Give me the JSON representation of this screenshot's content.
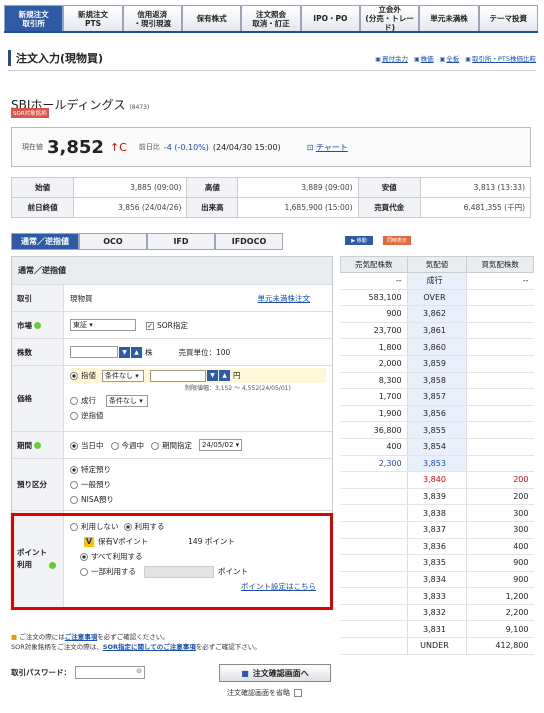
{
  "nav": [
    "新規注文\n取引所",
    "新規注文\nPTS",
    "信用返済\n・現引現渡",
    "保有株式",
    "注文照会\n取消・訂正",
    "IPO・PO",
    "立会外\n(分売・トレード)",
    "単元未満株",
    "テーマ投資"
  ],
  "page_title": "注文入力(現物買)",
  "title_links": [
    "買付余力",
    "株価",
    "全板",
    "取引所・PTS株価比較"
  ],
  "stock": {
    "name": "SBIホールディングス",
    "code": "(8473)",
    "badge": "SOR対象銘柄"
  },
  "price": {
    "label": "現在値",
    "value": "3,852",
    "arrow": "↑C",
    "prev_label": "前日比",
    "change": "-4 (-0.10%)",
    "time": "(24/04/30 15:00)",
    "chart_link": "チャート"
  },
  "ohlc": {
    "open_label": "始値",
    "open": "3,885 (09:00)",
    "high_label": "高値",
    "high": "3,889 (09:00)",
    "low_label": "安値",
    "low": "3,813 (13:33)",
    "prev_close_label": "前日終値",
    "prev_close": "3,856 (24/04/26)",
    "volume_label": "出来高",
    "volume": "1,685,900 (15:00)",
    "turnover_label": "売買代金",
    "turnover": "6,481,355 (千円)"
  },
  "order_tabs": [
    "通常／逆指値",
    "OCO",
    "IFD",
    "IFDOCO"
  ],
  "mini_buttons": [
    "▶ 移動",
    "同時表示"
  ],
  "form": {
    "header": "通常／逆指値",
    "trade_label": "取引",
    "trade_value": "現物買",
    "odd_lot_link": "単元未満株注文",
    "market_label": "市場",
    "market_value": "東証",
    "sor_label": "SOR指定",
    "qty_label": "株数",
    "qty_unit": "株",
    "unit_text": "売買単位：100",
    "price_label": "価格",
    "limit_label": "指値",
    "cond_none": "条件なし",
    "yen": "円",
    "limit_range": "制限値幅：3,152 〜 4,552(24/05/01)",
    "market_order_label": "成行",
    "stop_label": "逆指値",
    "period_label": "期間",
    "today": "当日中",
    "this_week": "今週中",
    "period_spec": "期間指定",
    "date": "24/05/02",
    "custody_label": "預り区分",
    "specific": "特定預り",
    "general": "一般預り",
    "nisa": "NISA預り",
    "point_label": "ポイント\n利用",
    "no_use": "利用しない",
    "use": "利用する",
    "v_point": "保有Vポイント",
    "v_point_value": "149 ポイント",
    "use_all": "すべて利用する",
    "use_part": "一部利用する",
    "points_unit": "ポイント",
    "point_settings": "ポイント設定はこちら"
  },
  "board": {
    "headers": [
      "売気配株数",
      "気配値",
      "買気配株数"
    ],
    "asks": [
      [
        "--",
        "成行",
        ""
      ],
      [
        "583,100",
        "OVER",
        ""
      ],
      [
        "900",
        "3,862",
        ""
      ],
      [
        "23,700",
        "3,861",
        ""
      ],
      [
        "1,800",
        "3,860",
        ""
      ],
      [
        "2,000",
        "3,859",
        ""
      ],
      [
        "8,300",
        "3,858",
        ""
      ],
      [
        "1,700",
        "3,857",
        ""
      ],
      [
        "1,900",
        "3,856",
        ""
      ],
      [
        "36,800",
        "3,855",
        ""
      ],
      [
        "400",
        "3,854",
        ""
      ],
      [
        "2,300",
        "3,853",
        ""
      ]
    ],
    "bids": [
      [
        "",
        "3,840",
        "200"
      ],
      [
        "",
        "3,839",
        "200"
      ],
      [
        "",
        "3,838",
        "300"
      ],
      [
        "",
        "3,837",
        "300"
      ],
      [
        "",
        "3,836",
        "400"
      ],
      [
        "",
        "3,835",
        "900"
      ],
      [
        "",
        "3,834",
        "900"
      ],
      [
        "",
        "3,833",
        "1,200"
      ],
      [
        "",
        "3,832",
        "2,200"
      ],
      [
        "",
        "3,831",
        "9,100"
      ],
      [
        "",
        "UNDER",
        "412,800"
      ]
    ],
    "bid_last_dash": "--"
  },
  "notice": {
    "line1a": "ご注文の際には",
    "line1link": "ご注意事項",
    "line1b": "を必ずご確認ください。",
    "line2a": "SOR対象銘柄をご注文の際は、",
    "line2link": "SOR指定に関してのご注意事項",
    "line2b": "を必ずご確認下さい。"
  },
  "password_label": "取引パスワード：",
  "confirm_button": "注文確認画面へ",
  "omit_label": "注文確認画面を省略"
}
